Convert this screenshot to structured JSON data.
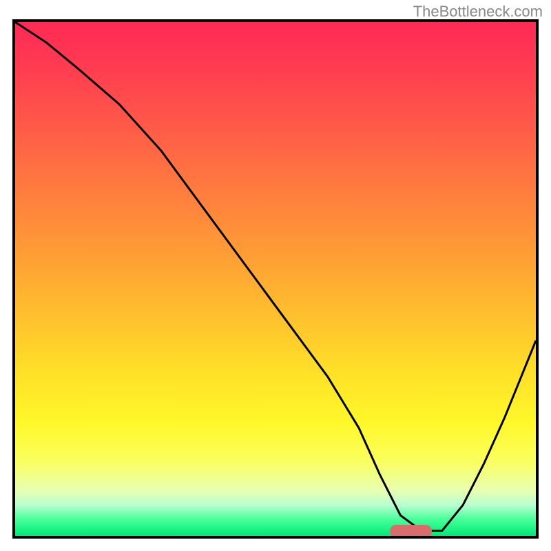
{
  "watermark": "TheBottleneck.com",
  "chart_data": {
    "type": "line",
    "title": "",
    "xlabel": "",
    "ylabel": "",
    "xlim": [
      0,
      100
    ],
    "ylim": [
      0,
      100
    ],
    "x": [
      0,
      6,
      12,
      20,
      28,
      36,
      44,
      52,
      60,
      66,
      70,
      74,
      78,
      82,
      86,
      90,
      94,
      98,
      100
    ],
    "values": [
      100,
      96,
      91,
      84,
      75,
      64,
      53,
      42,
      31,
      21,
      12,
      4,
      1,
      1,
      6,
      14,
      23,
      33,
      38
    ],
    "marker": {
      "x_start": 72,
      "x_end": 80,
      "y": 1
    },
    "background_gradient": {
      "top": "#ff2a55",
      "mid": "#ffe028",
      "bottom": "#00e878"
    }
  }
}
